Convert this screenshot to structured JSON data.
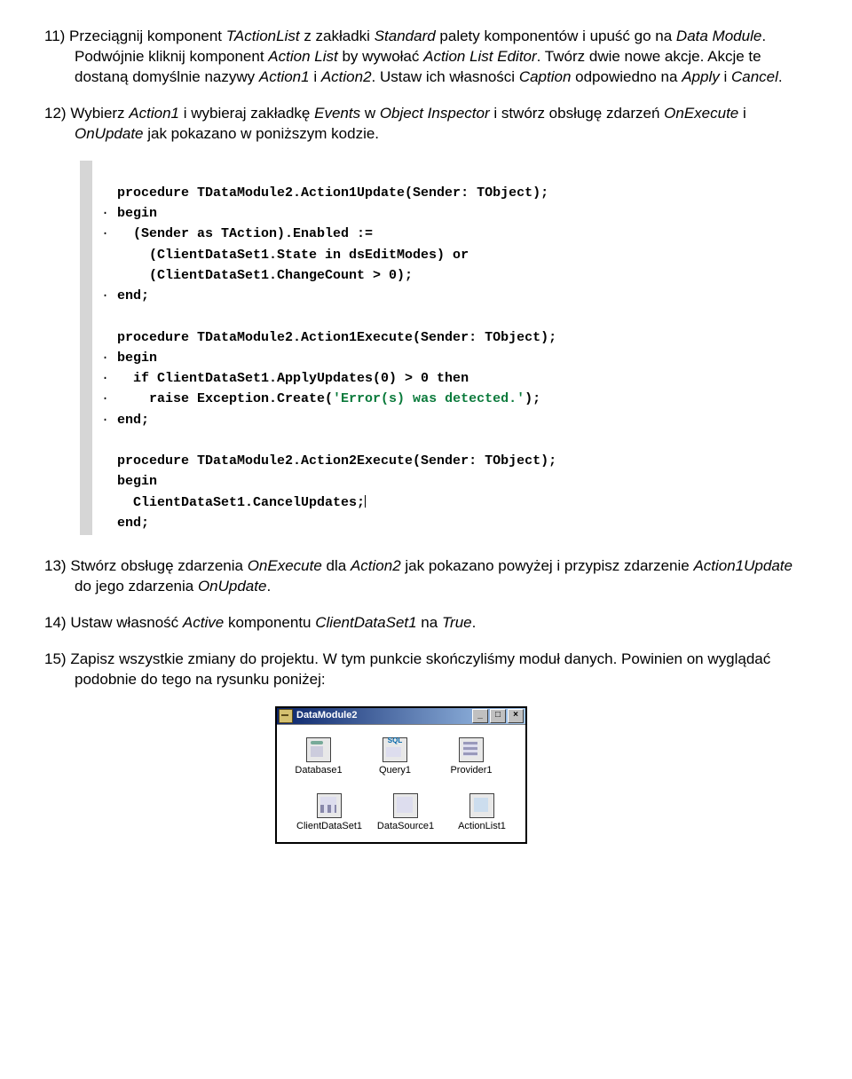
{
  "p11": {
    "num": "11)",
    "text": "Przeciągnij komponent ",
    "c1": "TActionList",
    "t2": " z zakładki ",
    "c2": "Standard",
    "t3": " palety komponentów i upuść go na ",
    "c3": "Data Module",
    "t4": ". Podwójnie kliknij komponent ",
    "c4": "Action List",
    "t5": " by wywołać ",
    "c5": "Action List Editor",
    "t6": ". Twórz dwie nowe akcje. Akcje te dostaną domyślnie nazywy ",
    "c6": "Action1",
    "t7": " i ",
    "c7": "Action2",
    "t8": ". Ustaw ich własności ",
    "c8": "Caption",
    "t9": " odpowiedno na ",
    "c9": "Apply",
    "t10": " i ",
    "c10": "Cancel",
    "t11": "."
  },
  "p12": {
    "num": "12)",
    "t1": "Wybierz ",
    "c1": "Action1",
    "t2": " i wybieraj zakładkę ",
    "c2": "Events",
    "t3": " w ",
    "c3": "Object Inspector",
    "t4": " i stwórz obsługę zdarzeń ",
    "c4": "OnExecute",
    "t5": " i ",
    "c5": "OnUpdate",
    "t6": " jak pokazano w poniższym kodzie."
  },
  "code": {
    "l1": "procedure TDataModule2.Action1Update(Sender: TObject);",
    "l2": "begin",
    "l3": "  (Sender as TAction).Enabled :=",
    "l4": "    (ClientDataSet1.State in dsEditModes) or",
    "l5": "    (ClientDataSet1.ChangeCount > 0);",
    "l6": "end;",
    "l7": "procedure TDataModule2.Action1Execute(Sender: TObject);",
    "l8": "begin",
    "l9": "  if ClientDataSet1.ApplyUpdates(0) > 0 then",
    "l10a": "    raise Exception.Create(",
    "l10s": "'Error(s) was detected.'",
    "l10b": ");",
    "l11": "end;",
    "l12": "procedure TDataModule2.Action2Execute(Sender: TObject);",
    "l13": "begin",
    "l14": "  ClientDataSet1.CancelUpdates;",
    "l15": "end;"
  },
  "p13": {
    "num": "13)",
    "t1": "Stwórz obsługę zdarzenia ",
    "c1": "OnExecute",
    "t2": " dla ",
    "c2": "Action2",
    "t3": " jak pokazano powyżej i przypisz zdarzenie ",
    "c3": "Action1Update",
    "t4": " do jego zdarzenia ",
    "c4": "OnUpdate",
    "t5": "."
  },
  "p14": {
    "num": "14)",
    "t1": "Ustaw własność ",
    "c1": "Active",
    "t2": " komponentu ",
    "c2": "ClientDataSet1",
    "t3": " na ",
    "c3": "True",
    "t4": "."
  },
  "p15": {
    "num": "15)",
    "t1": "Zapisz wszystkie zmiany do projektu. W tym punkcie skończyliśmy moduł danych. Powinien on wyglądać podobnie do tego na rysunku poniżej:"
  },
  "window": {
    "title": "DataModule2",
    "min": "_",
    "max": "□",
    "close": "×",
    "items_row1": [
      "Database1",
      "Query1",
      "Provider1"
    ],
    "items_row2": [
      "ClientDataSet1",
      "DataSource1",
      "ActionList1"
    ]
  }
}
